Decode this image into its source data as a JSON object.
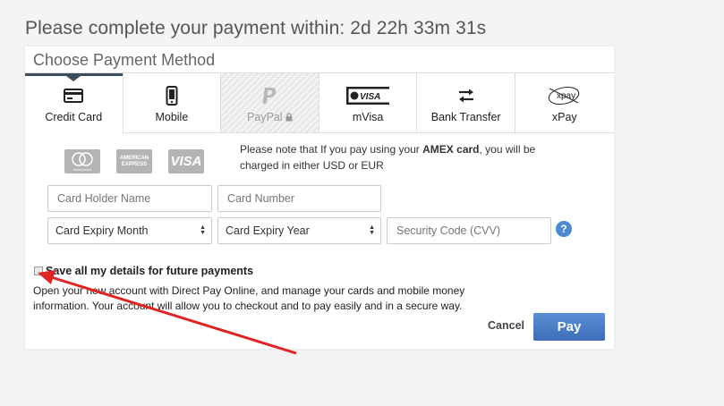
{
  "timer_text": "Please complete your payment within: 2d 22h 33m 31s",
  "card": {
    "title": "Choose Payment Method"
  },
  "tabs": [
    {
      "label": "Credit Card",
      "icon": "credit-card-icon"
    },
    {
      "label": "Mobile",
      "icon": "mobile-phone-icon"
    },
    {
      "label": "PayPal",
      "icon": "paypal-icon",
      "disabled": true
    },
    {
      "label": "mVisa",
      "icon": "mvisa-icon"
    },
    {
      "label": "Bank Transfer",
      "icon": "bank-transfer-icon"
    },
    {
      "label": "xPay",
      "icon": "xpay-icon"
    }
  ],
  "logos": [
    "mastercard",
    "AMERICAN EXPRESS",
    "VISA"
  ],
  "amex_note": {
    "before": "Please note that If you pay using your ",
    "bold": "AMEX card",
    "after": ", you will be charged in either USD or EUR"
  },
  "form": {
    "card_holder_placeholder": "Card Holder Name",
    "card_number_placeholder": "Card Number",
    "expiry_month_selected": "Card Expiry Month",
    "expiry_year_selected": "Card Expiry Year",
    "cvv_placeholder": "Security Code (CVV)",
    "help_label": "?"
  },
  "save_details_label": "Save all my details for future payments",
  "info_text": "Open your new account with Direct Pay Online, and manage your cards and mobile money information. Your account will allow you to checkout and to pay easily and in a secure way.",
  "actions": {
    "cancel_label": "Cancel",
    "pay_label": "Pay"
  },
  "colors": {
    "accent": "#3d6fb8",
    "annotation_arrow": "#e02424"
  }
}
